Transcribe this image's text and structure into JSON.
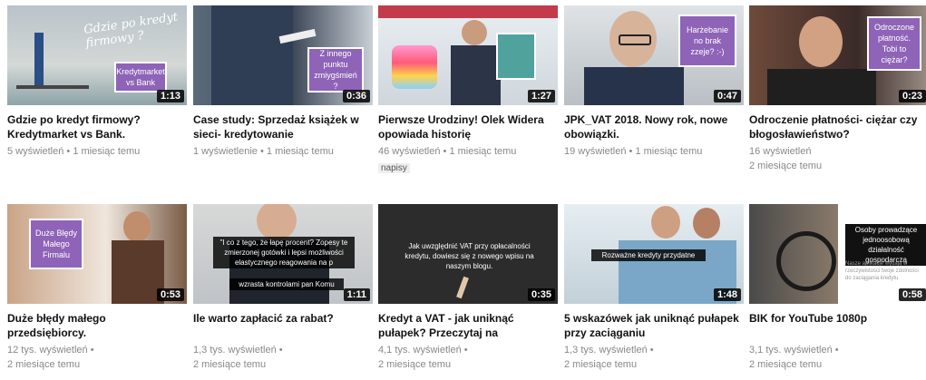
{
  "videos": [
    {
      "title": "Gdzie po kredyt firmowy? Kredytmarket vs Bank.",
      "views": "5 wyświetleń",
      "age": "1 miesiąc temu",
      "duration": "1:13",
      "overlay": "Kredytmarket vs Bank",
      "script_text": "Gdzie po kredyt firmowy ?"
    },
    {
      "title": "Case study: Sprzedaż książek w sieci- kredytowanie",
      "views": "1 wyświetlenie",
      "age": "1 miesiąc temu",
      "duration": "0:36",
      "overlay": "Z innego punktu zmiygśmień ?"
    },
    {
      "title": "Pierwsze Urodziny! Olek Widera opowiada historię",
      "views": "46 wyświetleń",
      "age": "1 miesiąc temu",
      "duration": "1:27",
      "tag": "napisy"
    },
    {
      "title": "JPK_VAT 2018. Nowy rok, nowe obowiązki.",
      "views": "19 wyświetleń",
      "age": "1 miesiąc temu",
      "duration": "0:47",
      "overlay": "Harżebanie no brak zzeje? :-)"
    },
    {
      "title": "Odroczenie płatności- ciężar czy błogosławieństwo?",
      "views": "16 wyświetleń",
      "age": "2 miesiące temu",
      "duration": "0:23",
      "overlay": "Odroczone płatność. Tobi to ciężar?"
    },
    {
      "title": "Duże błędy małego przedsiębiorcy.",
      "views": "12 tys. wyświetleń",
      "age": "2 miesiące temu",
      "duration": "0:53",
      "overlay": "Duże Błędy Małego Firmalu"
    },
    {
      "title": "Ile warto zapłacić za rabat?",
      "views": "1,3 tys. wyświetleń",
      "age": "2 miesiące temu",
      "duration": "1:11",
      "caption": "\"I co z tego, że łapę procent? Zopesy te zmierzonej gotówki i lepsi możliwości elastycznego reagowania na p",
      "caption2": "wzrasta kontrolami pan Komu"
    },
    {
      "title": "Kredyt a VAT - jak uniknąć pułapek? Przeczytaj na",
      "views": "4,1 tys. wyświetleń",
      "age": "2 miesiące temu",
      "duration": "0:35",
      "caption": "Jak uwzględnić VAT przy opłacalności kredytu, dowiesz się z nowego wpisu na naszym blogu."
    },
    {
      "title": "5 wskazówek jak uniknąć pułapek przy zaciąganiu",
      "views": "1,3 tys. wyświetleń",
      "age": "2 miesiące temu",
      "duration": "1:48",
      "caption": "Rozważne kredyty przydatne"
    },
    {
      "title": "BIK for YouTube 1080p",
      "views": "3,1 tys. wyświetleń",
      "age": "2 miesiące temu",
      "duration": "0:58",
      "caption": "Osoby prowadzące jednoosobową działalność gospodarczą",
      "caption2": "Nasze aplikacje wydają w rzeczywistości twoje zdolności do zaciągania kredytu"
    }
  ],
  "colors": {
    "accent_purple": "#8e63b8",
    "duration_bg": "#000000",
    "meta_gray": "#888888"
  }
}
